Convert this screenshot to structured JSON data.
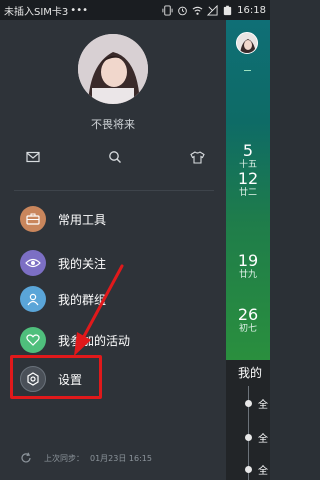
{
  "status_bar": {
    "carrier": "未插入SIM卡3",
    "dots": "•••",
    "time": "16:18"
  },
  "drawer": {
    "username": "不畏将来",
    "quick_actions": [
      {
        "icon": "mail-icon"
      },
      {
        "icon": "search-icon"
      },
      {
        "icon": "tshirt-icon"
      }
    ],
    "menu": [
      {
        "label": "常用工具",
        "icon": "toolbox-icon",
        "color": "#c9865c"
      },
      {
        "label": "我的关注",
        "icon": "eye-icon",
        "color": "#7c6fc4"
      },
      {
        "label": "我的群组",
        "icon": "group-icon",
        "color": "#5aa5d8"
      },
      {
        "label": "我参加的活动",
        "icon": "heart-icon",
        "color": "#4fbf7c"
      },
      {
        "label": "设置",
        "icon": "settings-icon",
        "color": "#4a5058"
      }
    ],
    "sync": {
      "label": "上次同步：",
      "time": "01月23日 16:15"
    }
  },
  "calendar": {
    "dates": [
      {
        "num": "5",
        "lbl": "十五"
      },
      {
        "num": "12",
        "lbl": "廿二"
      },
      {
        "num": "19",
        "lbl": "廿九"
      },
      {
        "num": "26",
        "lbl": "初七"
      }
    ],
    "section_title": "我的",
    "entries": [
      "全",
      "全",
      "全"
    ]
  },
  "colors": {
    "highlight": "#e0191b",
    "arrow": "#e0191b"
  }
}
